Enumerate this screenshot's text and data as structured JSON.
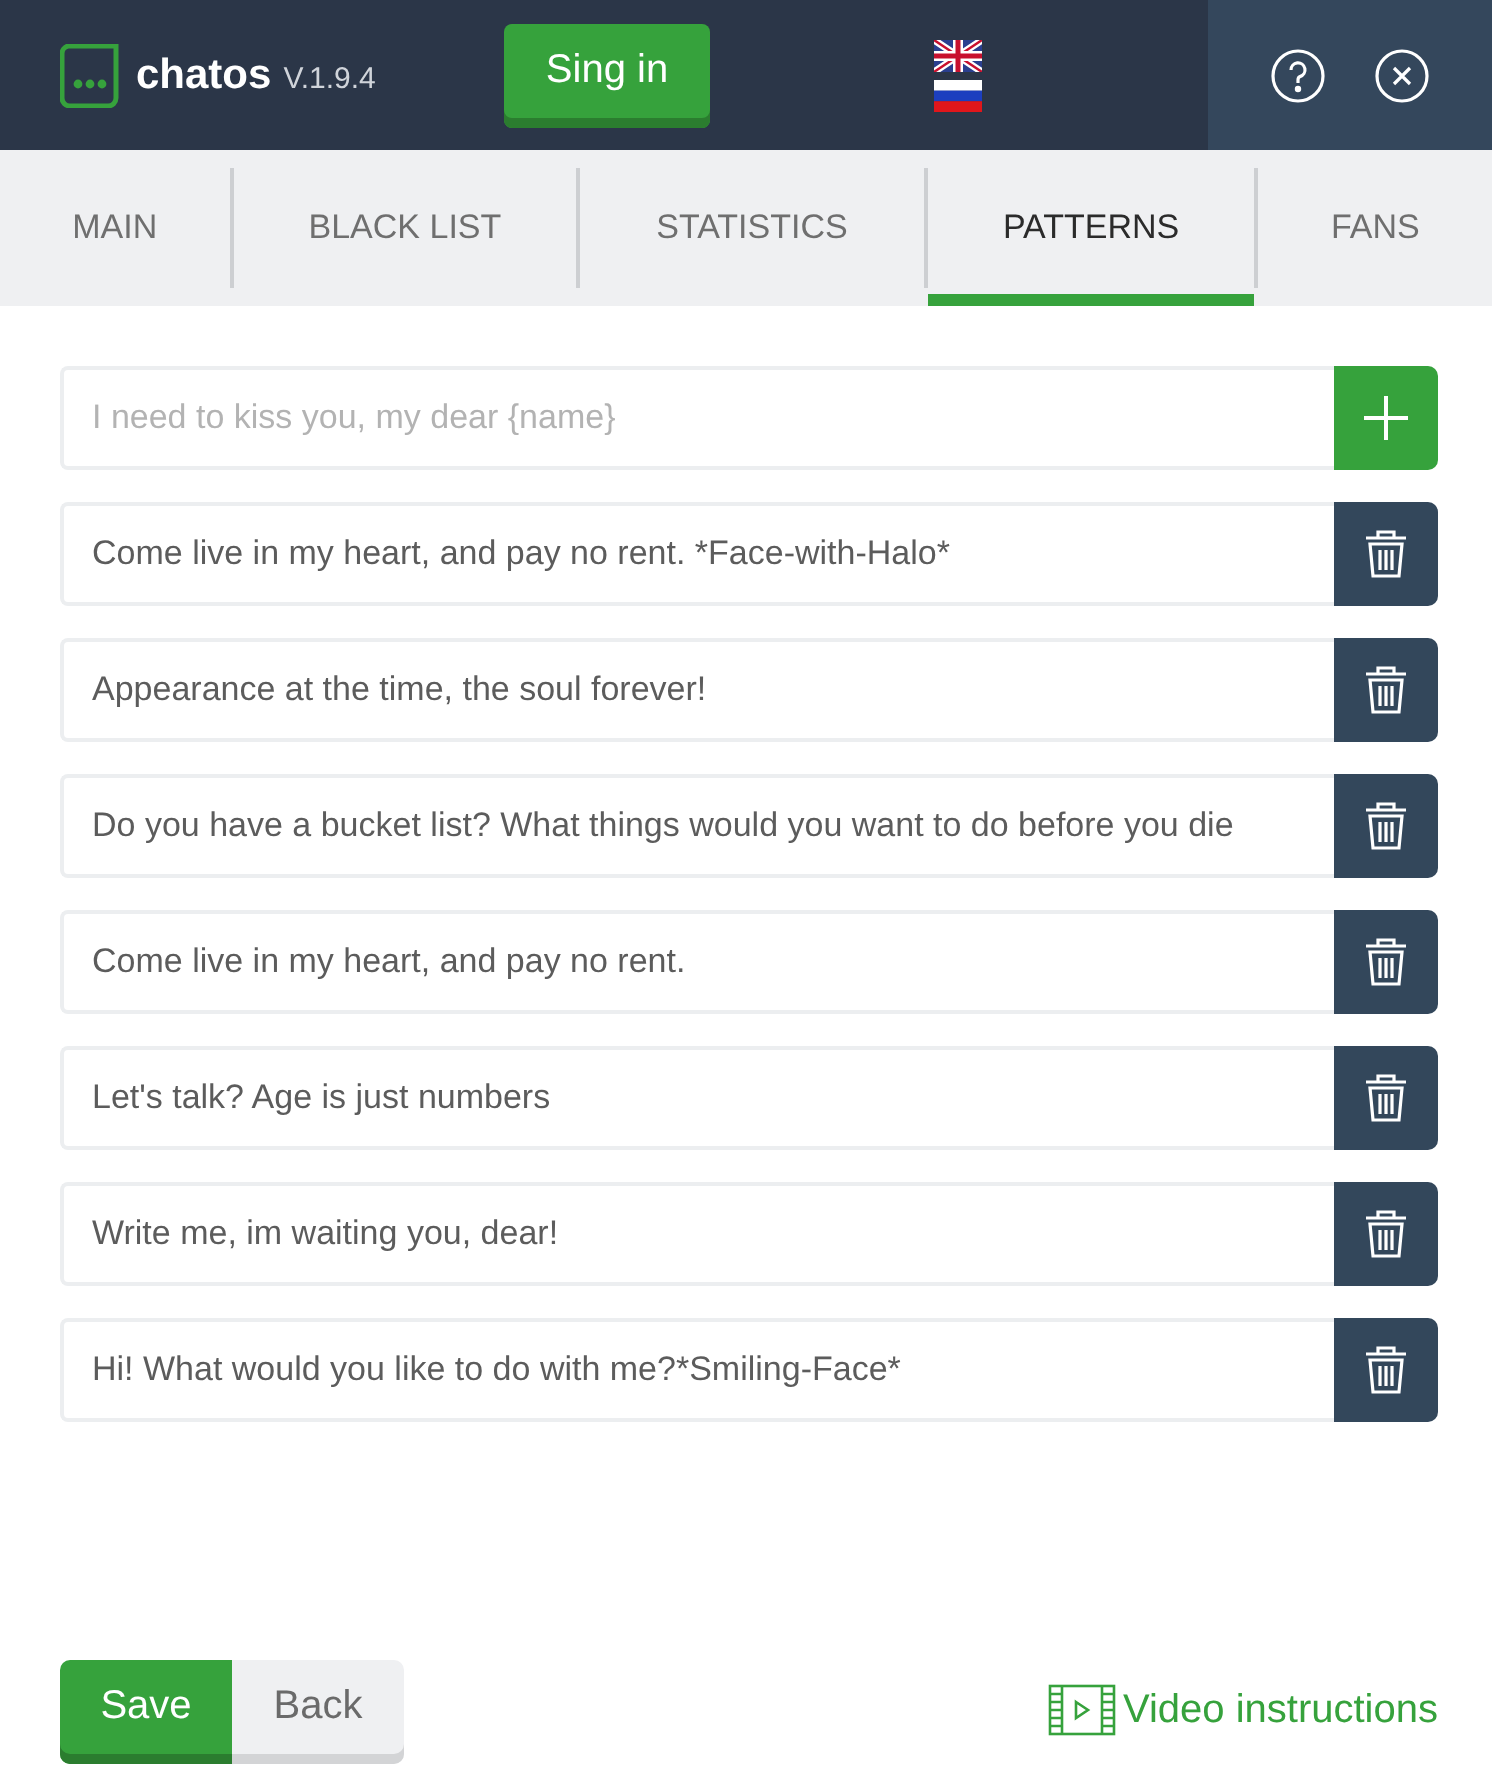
{
  "header": {
    "app_name": "chatos",
    "version": "V.1.9.4",
    "sign_in": "Sing in"
  },
  "tabs": [
    {
      "label": "MAIN",
      "selected": false
    },
    {
      "label": "BLACK LIST",
      "selected": false
    },
    {
      "label": "STATISTICS",
      "selected": false
    },
    {
      "label": "PATTERNS",
      "selected": true
    },
    {
      "label": "FANS",
      "selected": false
    }
  ],
  "new_pattern": {
    "placeholder": "I need to kiss you, my dear {name}"
  },
  "patterns": [
    "Come live in my heart, and pay no rent. *Face-with-Halo*",
    "Appearance at the time, the soul forever!",
    "Do you have a bucket list? What things would you want to do before you die",
    "Come live in my heart, and pay no rent.",
    "Let's talk? Age is just numbers",
    "Write me, im waiting you, dear!",
    "Hi! What would you like to do with me?*Smiling-Face*"
  ],
  "footer": {
    "save": "Save",
    "back": "Back",
    "video_link": "Video instructions"
  }
}
